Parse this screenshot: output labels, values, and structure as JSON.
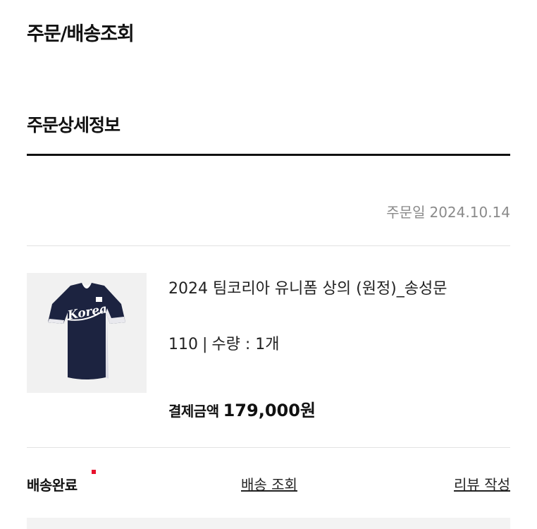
{
  "header": {
    "title": "주문/배송조회"
  },
  "detail": {
    "section_title": "주문상세정보",
    "order_date_label": "주문일",
    "order_date": "2024.10.14"
  },
  "product": {
    "image_icon": "baseball-jersey-image",
    "image_text": "Korea",
    "name": "2024 팀코리아 유니폼 상의 (원정)_송성문",
    "size": "110",
    "separator": "|",
    "quantity": "수량 : 1개",
    "payment_label": "결제금액",
    "payment_amount": "179,000원"
  },
  "footer": {
    "status": "배송완료",
    "track_link": "배송 조회",
    "review_link": "리뷰 작성"
  },
  "colors": {
    "accent_red": "#e8112d",
    "jersey_navy": "#1c2340",
    "muted_text": "#8a8a8a"
  }
}
